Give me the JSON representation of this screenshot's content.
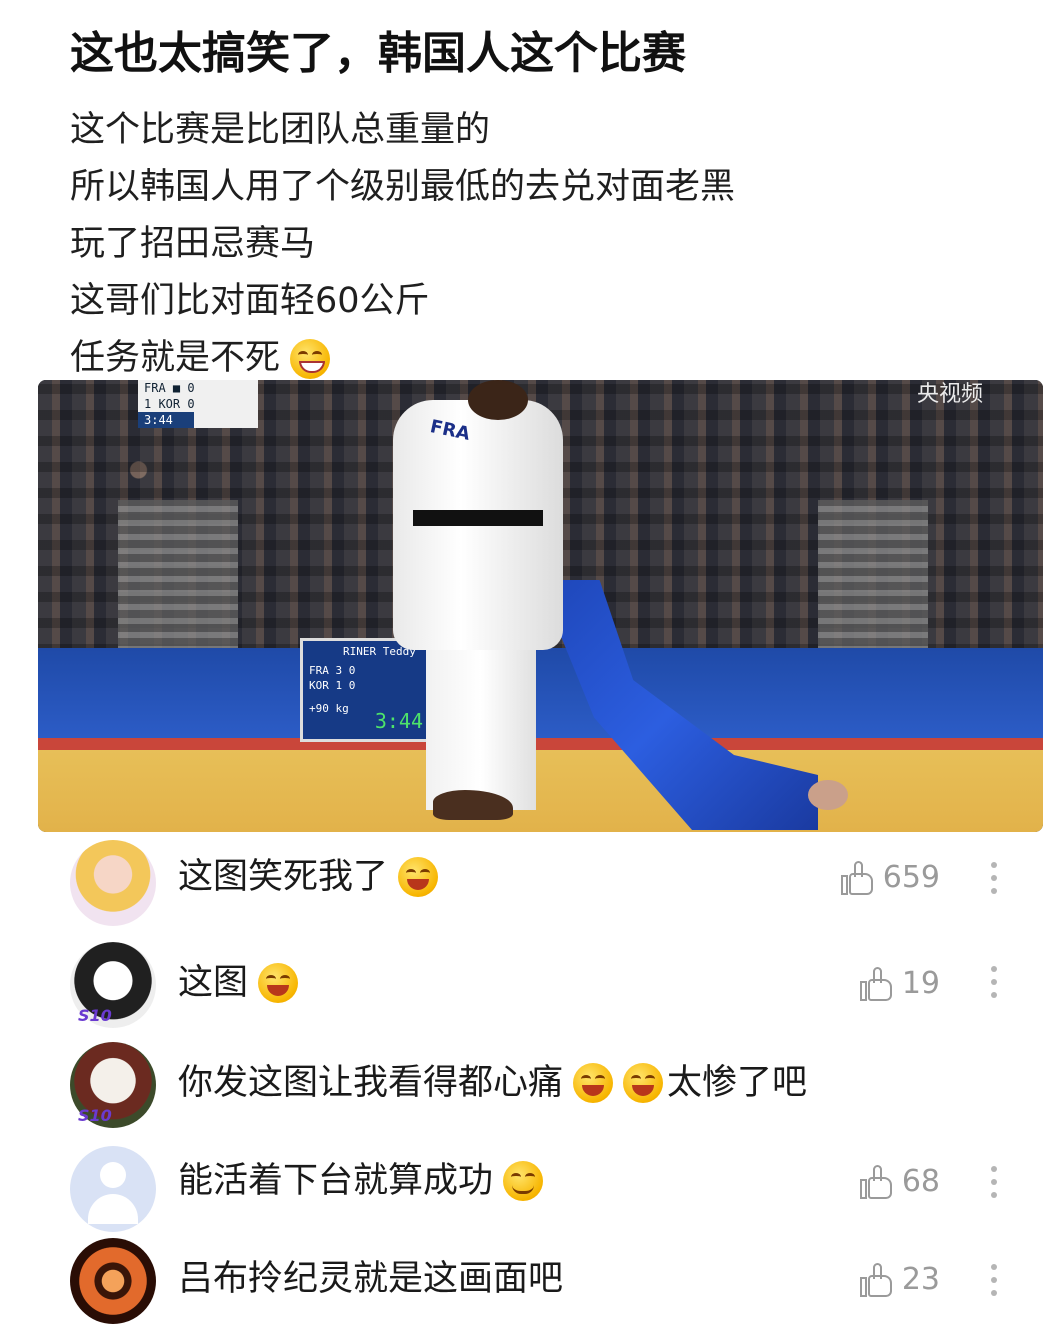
{
  "post": {
    "title": "这也太搞笑了，韩国人这个比赛",
    "lines": [
      "这个比赛是比团队总重量的",
      "所以韩国人用了个级别最低的去兑对面老黑",
      "玩了招田忌赛马",
      "这哥们比对面轻60公斤",
      "任务就是不死"
    ]
  },
  "photo": {
    "watermark": "央视频",
    "scorebug": {
      "row1": "FRA ■ 0",
      "row2": "1  KOR   0",
      "time": "3:44"
    },
    "board": {
      "name": "RINER Teddy",
      "fra": "FRA 3   0",
      "kor": "KOR 1   0",
      "weight": "+90 kg",
      "clock": "3:44"
    },
    "jersey": "FRA"
  },
  "comments": [
    {
      "text": "这图笑死我了",
      "likes": "659",
      "emoji": "laugh"
    },
    {
      "text": "这图",
      "likes": "19",
      "emoji": "laugh",
      "badge": "S10"
    },
    {
      "text_a": "你发这图让我看得都心痛",
      "text_b": "太惨了吧",
      "badge": "S10"
    },
    {
      "text": "能活着下台就算成功",
      "likes": "68",
      "emoji": "smile"
    },
    {
      "text": "吕布拎纪灵就是这画面吧",
      "likes": "23"
    }
  ]
}
